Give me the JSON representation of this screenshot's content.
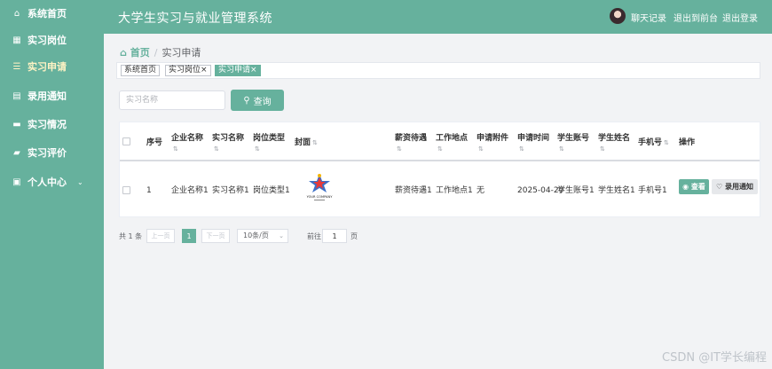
{
  "app_title": "大学生实习与就业管理系统",
  "header": {
    "chat_record": "聊天记录",
    "exit_front": "退出到前台",
    "logout": "退出登录"
  },
  "sidebar": {
    "items": [
      {
        "label": "系统首页",
        "icon": "home-icon"
      },
      {
        "label": "实习岗位",
        "icon": "grid-icon"
      },
      {
        "label": "实习申请",
        "icon": "list-icon",
        "active": true
      },
      {
        "label": "录用通知",
        "icon": "document-icon"
      },
      {
        "label": "实习情况",
        "icon": "ticket-icon"
      },
      {
        "label": "实习评价",
        "icon": "briefcase-icon"
      },
      {
        "label": "个人中心",
        "icon": "user-card-icon"
      }
    ]
  },
  "breadcrumb": {
    "home": "首页",
    "current": "实习申请"
  },
  "tabs": [
    {
      "label": "系统首页",
      "closable": false
    },
    {
      "label": "实习岗位",
      "closable": true
    },
    {
      "label": "实习申请",
      "closable": true,
      "active": true
    }
  ],
  "search": {
    "placeholder": "实习名称",
    "button": "查询"
  },
  "table": {
    "columns": {
      "index": "序号",
      "company": "企业名称",
      "intern_name": "实习名称",
      "position_type": "岗位类型",
      "cover": "封面",
      "salary": "薪资待遇",
      "location": "工作地点",
      "attachment": "申请附件",
      "apply_time": "申请时间",
      "student_account": "学生账号",
      "student_name": "学生姓名",
      "phone": "手机号",
      "actions": "操作"
    },
    "rows": [
      {
        "index": "1",
        "company": "企业名称1",
        "intern_name": "实习名称1",
        "position_type": "岗位类型1",
        "cover_text": "YOUR COMPANY",
        "salary": "薪资待遇1",
        "location": "工作地点1",
        "attachment": "无",
        "apply_time": "2025-04-20",
        "student_account": "学生账号1",
        "student_name": "学生姓名1",
        "phone": "手机号1",
        "view": "查看",
        "notice": "录用通知"
      }
    ]
  },
  "pagination": {
    "total": "共 1 条",
    "prev": "上一页",
    "page": "1",
    "next": "下一页",
    "page_size": "10条/页",
    "goto": "前往",
    "goto_value": "1",
    "page_unit": "页"
  },
  "watermark": "CSDN @IT学长编程",
  "colors": {
    "primary": "#66b19d",
    "active_menu": "#fff3c4",
    "background": "#f2f3f5"
  }
}
